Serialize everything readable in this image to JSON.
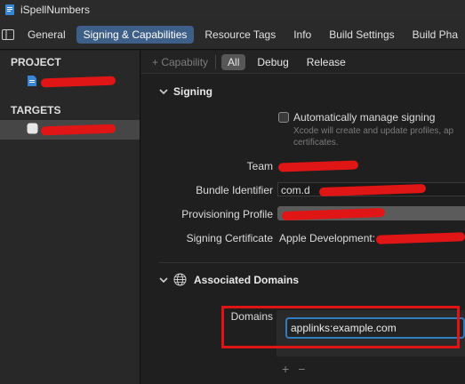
{
  "window": {
    "title": "iSpellNumbers"
  },
  "tabs": [
    {
      "label": "General"
    },
    {
      "label": "Signing & Capabilities",
      "active": true
    },
    {
      "label": "Resource Tags"
    },
    {
      "label": "Info"
    },
    {
      "label": "Build Settings"
    },
    {
      "label": "Build Pha"
    }
  ],
  "sidebar": {
    "project_header": "PROJECT",
    "targets_header": "TARGETS"
  },
  "capability_bar": {
    "add_label": "+ Capability",
    "filters": [
      {
        "label": "All",
        "active": true
      },
      {
        "label": "Debug"
      },
      {
        "label": "Release"
      }
    ]
  },
  "signing": {
    "header": "Signing",
    "auto_manage_label": "Automatically manage signing",
    "auto_manage_checked": false,
    "auto_manage_hint": "Xcode will create and update profiles, ap certificates.",
    "team_label": "Team",
    "bundle_id_label": "Bundle Identifier",
    "bundle_id_value": "com.d",
    "provisioning_label": "Provisioning Profile",
    "certificate_label": "Signing Certificate",
    "certificate_value": "Apple Development:"
  },
  "associated_domains": {
    "header": "Associated Domains",
    "domains_label": "Domains",
    "domains": [
      "applinks:example.com"
    ],
    "add_symbol": "+",
    "remove_symbol": "−"
  },
  "colors": {
    "accent": "#3d5f88",
    "redaction": "#e01515",
    "focus_ring": "#2f7cc0"
  },
  "icons": {
    "app": "app-document-icon",
    "sidebar": "sidebar-toggle-icon",
    "project": "project-file-icon",
    "target": "target-app-icon",
    "capability": "globe-icon"
  }
}
